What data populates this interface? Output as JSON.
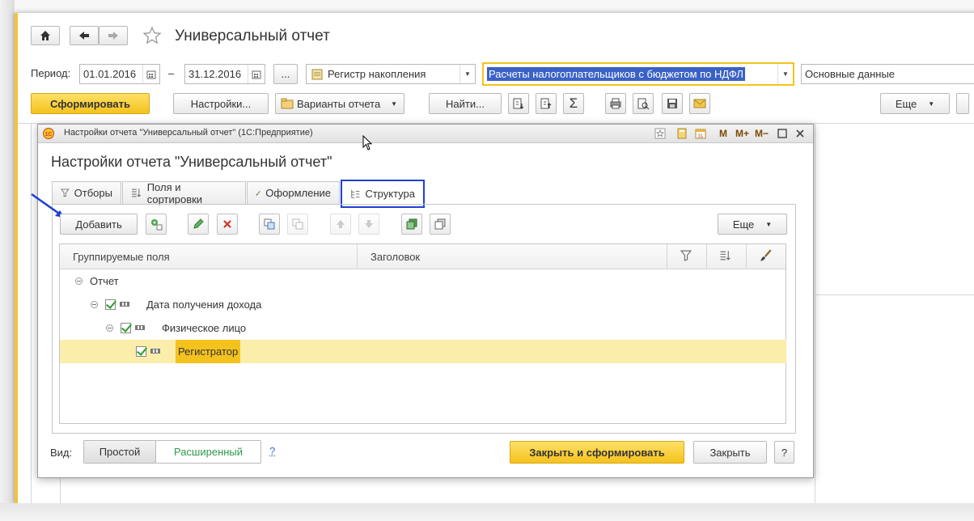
{
  "app": {
    "title": "Универсальный отчет"
  },
  "toolbar": {
    "period_label": "Период:",
    "date_from": "01.01.2016",
    "dash": "–",
    "date_to": "31.12.2016",
    "ellipsis": "...",
    "source_type": "Регистр накопления",
    "source_name": "Расчеты налогоплательщиков с бюджетом по НДФЛ",
    "data_set": "Основные данные",
    "generate": "Сформировать",
    "settings": "Настройки...",
    "variants": "Варианты отчета",
    "find": "Найти...",
    "more": "Еще"
  },
  "dialog": {
    "window_title": "Настройки отчета \"Универсальный отчет\" (1С:Предприятие)",
    "heading": "Настройки отчета \"Универсальный отчет\"",
    "tabs": [
      {
        "label": "Отборы"
      },
      {
        "label": "Поля и сортировки"
      },
      {
        "label": "Оформление"
      },
      {
        "label": "Структура"
      }
    ],
    "add_button": "Добавить",
    "more_button": "Еще",
    "columns": [
      "Группируемые поля",
      "Заголовок"
    ],
    "tree": [
      {
        "label": "Отчет"
      },
      {
        "label": "Дата получения дохода"
      },
      {
        "label": "Физическое лицо"
      },
      {
        "label": "Регистратор"
      }
    ],
    "view_label": "Вид:",
    "view_simple": "Простой",
    "view_extended": "Расширенный",
    "help": "?",
    "close_generate": "Закрыть и сформировать",
    "close": "Закрыть",
    "help_button": "?",
    "title_buttons": {
      "m": "M",
      "mplus": "M+",
      "mminus": "M−"
    }
  },
  "colors": {
    "accent_yellow": "#f4c21d",
    "highlight_blue": "#1f3fd6",
    "selection_row": "#fbeeab",
    "arrow_blue": "#1a3fd0"
  }
}
